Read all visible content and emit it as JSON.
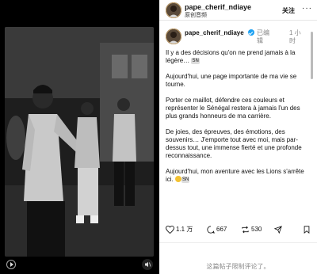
{
  "header": {
    "username": "pape_cherif_ndiaye",
    "audio_label": "原创音频",
    "follow_label": "关注",
    "more_glyph": "···"
  },
  "post": {
    "username": "pape_cherif_ndiaye",
    "edited_label": "已编辑",
    "time_label": "1 小时",
    "paragraphs": [
      "Il y a des décisions qu'on ne prend jamais à la légère…",
      "Aujourd'hui, une page importante de ma vie se tourne.",
      "Porter ce maillot, défendre ces couleurs et représenter le Sénégal restera à jamais l'un des plus grands honneurs de ma carrière.",
      "De joies, des épreuves, des émotions, des souvenirs… J'emporte tout avec moi, mais par-dessus tout, une immense fierté et une profonde reconnaissance.",
      "Aujourd'hui, mon aventure avec les Lions s'arrête ici."
    ],
    "badge_text": "SN"
  },
  "actions": {
    "likes": "1.1 万",
    "comments": "667",
    "reposts": "530"
  },
  "footer": {
    "comments_off": "这篇帖子限制评论了。"
  },
  "colors": {
    "verified": "#1da1f2",
    "photo_tone": "grayscale"
  }
}
